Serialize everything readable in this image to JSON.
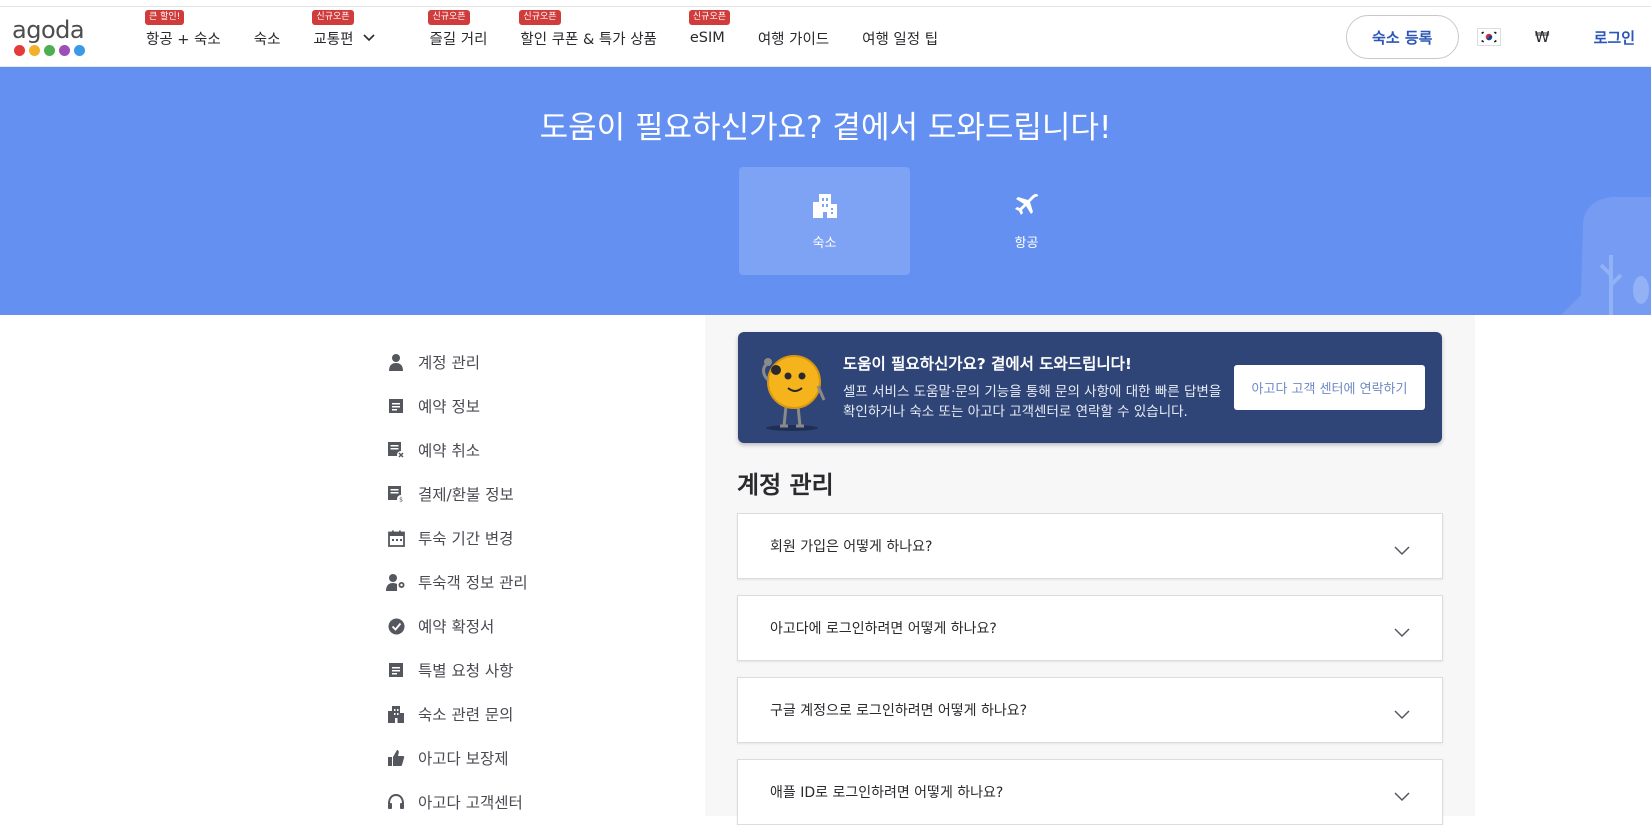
{
  "brand": {
    "logo_text": "agoda",
    "dot_colors": [
      "#e53a3a",
      "#f4b02a",
      "#4caf50",
      "#9c4fb4",
      "#3a9ae6"
    ]
  },
  "nav": {
    "items": [
      {
        "label": "항공 + 숙소",
        "badge": "큰 할인!"
      },
      {
        "label": "숙소",
        "badge": ""
      },
      {
        "label": "교통편",
        "badge": "신규오픈",
        "has_dropdown": true
      },
      {
        "label": "즐길 거리",
        "badge": "신규오픈"
      },
      {
        "label": "할인 쿠폰 & 특가 상품",
        "badge": "신규오픈"
      },
      {
        "label": "eSIM",
        "badge": "신규오픈"
      },
      {
        "label": "여행 가이드",
        "badge": ""
      },
      {
        "label": "여행 일정 팁",
        "badge": ""
      }
    ],
    "list_property": "숙소 등록",
    "currency": "₩",
    "login": "로그인"
  },
  "hero": {
    "title": "도움이 필요하신가요? 곁에서 도와드립니다!",
    "tabs": [
      {
        "label": "숙소",
        "icon": "hotel-icon",
        "active": true
      },
      {
        "label": "항공",
        "icon": "airplane-icon",
        "active": false
      }
    ]
  },
  "sidebar": {
    "items": [
      {
        "label": "계정 관리",
        "icon": "person-icon"
      },
      {
        "label": "예약 정보",
        "icon": "document-icon"
      },
      {
        "label": "예약 취소",
        "icon": "document-cancel-icon"
      },
      {
        "label": "결제/환불 정보",
        "icon": "document-payment-icon"
      },
      {
        "label": "투숙 기간 변경",
        "icon": "calendar-icon"
      },
      {
        "label": "투숙객 정보 관리",
        "icon": "person-gear-icon"
      },
      {
        "label": "예약 확정서",
        "icon": "check-circle-icon"
      },
      {
        "label": "특별 요청 사항",
        "icon": "document-icon"
      },
      {
        "label": "숙소 관련 문의",
        "icon": "hotel-icon"
      },
      {
        "label": "아고다 보장제",
        "icon": "thumbs-up-icon"
      },
      {
        "label": "아고다 고객센터",
        "icon": "headset-icon"
      }
    ]
  },
  "promo": {
    "title": "도움이 필요하신가요? 곁에서 도와드립니다!",
    "text": "셀프 서비스 도움말·문의 기능을 통해 문의 사항에 대한 빠른 답변을 확인하거나 숙소 또는 아고다 고객센터로 연락할 수 있습니다.",
    "button": "아고다 고객 센터에 연락하기"
  },
  "faq_section": {
    "title": "계정 관리",
    "questions": [
      "회원 가입은 어떻게 하나요?",
      "아고다에 로그인하려면 어떻게 하나요?",
      "구글 계정으로 로그인하려면 어떻게 하나요?",
      "애플 ID로 로그인하려면 어떻게 하나요?"
    ]
  },
  "colors": {
    "hero_bg": "#6490f2",
    "promo_bg": "#2f4577",
    "badge": "#d03c3c",
    "link_blue": "#2a56b8"
  }
}
